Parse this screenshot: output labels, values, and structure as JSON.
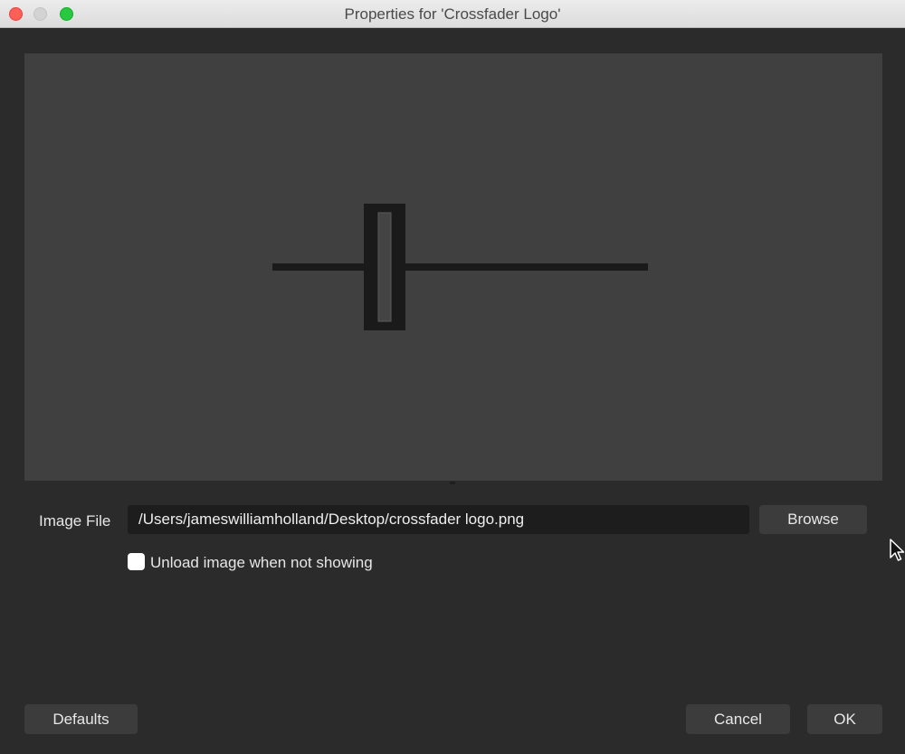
{
  "window": {
    "title": "Properties for 'Crossfader Logo'"
  },
  "image_file": {
    "label": "Image File",
    "value": "/Users/jameswilliamholland/Desktop/crossfader logo.png",
    "browse_label": "Browse"
  },
  "unload_option": {
    "label": "Unload image when not showing",
    "checked": false
  },
  "footer": {
    "defaults_label": "Defaults",
    "cancel_label": "Cancel",
    "ok_label": "OK"
  },
  "colors": {
    "background": "#2b2b2b",
    "preview_background": "#404040",
    "field_background": "#1d1d1d",
    "button_background": "#3c3c3c"
  }
}
